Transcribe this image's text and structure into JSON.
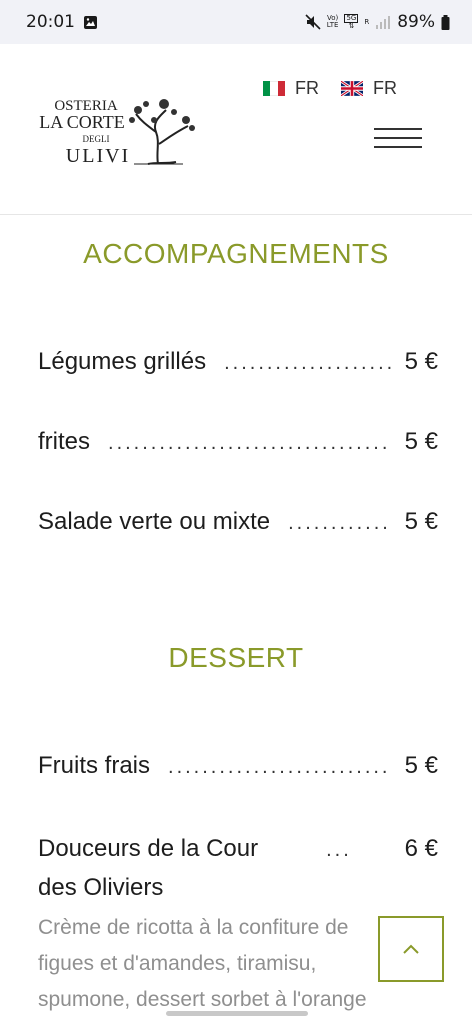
{
  "status_bar": {
    "time": "20:01",
    "signal_labels": [
      "Vo)",
      "LTE",
      "5G",
      "R"
    ],
    "battery": "89%"
  },
  "header": {
    "logo_text": {
      "line1": "OSTERIA",
      "line2": "LA CORTE",
      "line3": "DEGLI",
      "line4": "ULIVI"
    },
    "languages": [
      {
        "flag": "italy-flag",
        "label": "FR"
      },
      {
        "flag": "uk-flag",
        "label": "FR"
      }
    ]
  },
  "sections": [
    {
      "title": "ACCOMPAGNEMENTS",
      "items": [
        {
          "name": "Légumes grillés",
          "price": "5 €"
        },
        {
          "name": "frites",
          "price": "5 €"
        },
        {
          "name": "Salade verte ou mixte",
          "price": "5 €"
        }
      ]
    },
    {
      "title": "DESSERT",
      "items": [
        {
          "name": "Fruits frais",
          "price": "5 €"
        },
        {
          "name": "Douceurs de la Cour des Oliviers",
          "name_line1": "Douceurs de la Cour",
          "name_line2": "des Oliviers",
          "price": "6 €",
          "description": "Crème de ricotta à la confiture de figues et d'amandes, tiramisu, spumone, dessert sorbet à l'orange"
        }
      ]
    }
  ],
  "colors": {
    "accent": "#8a9a2a",
    "status_bg": "#f1f2f7"
  }
}
